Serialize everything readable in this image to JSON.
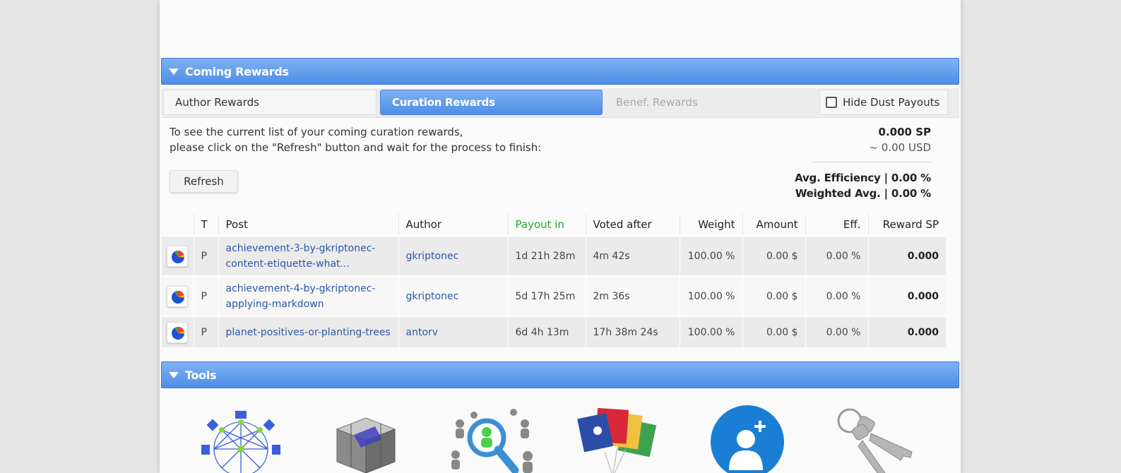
{
  "coming_rewards": {
    "title": "Coming Rewards"
  },
  "tabs": {
    "author": "Author Rewards",
    "curation": "Curation Rewards",
    "benef": "Benef. Rewards",
    "hide_dust": "Hide Dust Payouts"
  },
  "info": {
    "line1": "To see the current list of your coming curation rewards,",
    "line2": "please click on the \"Refresh\" button and wait for the process to finish:",
    "refresh": "Refresh"
  },
  "summary": {
    "sp": "0.000 SP",
    "usd": "~ 0.00 USD",
    "avg_eff": "Avg. Efficiency | 0.00 %",
    "weighted_avg": "Weighted Avg. | 0.00 %"
  },
  "table": {
    "headers": [
      "",
      "T",
      "Post",
      "Author",
      "Payout in",
      "Voted after",
      "Weight",
      "Amount",
      "Eff.",
      "Reward SP"
    ],
    "rows": [
      {
        "type": "P",
        "post_line1": "achievement-3-by-gkriptonec-",
        "post_line2": "content-etiquette-what...",
        "author": "gkriptonec",
        "payout": "1d 21h 28m",
        "voted_after": "4m 42s",
        "weight": "100.00 %",
        "amount": "0.00 $",
        "eff": "0.00 %",
        "reward": "0.000"
      },
      {
        "type": "P",
        "post_line1": "achievement-4-by-gkriptonec-",
        "post_line2": "applying-markdown",
        "author": "gkriptonec",
        "payout": "5d 17h 25m",
        "voted_after": "2m 36s",
        "weight": "100.00 %",
        "amount": "0.00 $",
        "eff": "0.00 %",
        "reward": "0.000"
      },
      {
        "type": "P",
        "post_line1": "planet-positives-or-planting-trees",
        "post_line2": "",
        "author": "antorv",
        "payout": "6d 4h 13m",
        "voted_after": "17h 38m 24s",
        "weight": "100.00 %",
        "amount": "0.00 $",
        "eff": "0.00 %",
        "reward": "0.000"
      }
    ]
  },
  "tools": {
    "title": "Tools"
  },
  "colors": {
    "accent": "#4e8de6",
    "payout_header": "#22a82a",
    "link": "#2d57a6"
  },
  "icons": [
    "pie-chart-icon",
    "network-icon",
    "cube-icon",
    "people-search-icon",
    "flags-icon",
    "add-user-icon",
    "keys-icon"
  ]
}
